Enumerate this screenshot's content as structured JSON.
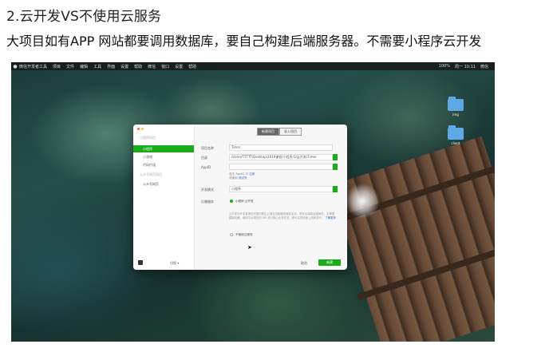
{
  "heading": "2.云开发VS不使用云服务",
  "paragraph": "大项目如有APP 网站都要调用数据库，要自己构建后端服务器。不需要小程序云开发",
  "menubar": {
    "apple": "",
    "items": [
      "微信开发者工具",
      "项目",
      "文件",
      "编辑",
      "工具",
      "界面",
      "设置",
      "帮助",
      "微信",
      "窗口",
      "设置",
      "帮助"
    ],
    "status": [
      "100%",
      "周一 10:11",
      "微信"
    ]
  },
  "desktop_icons": [
    {
      "label": "img",
      "icon": "folder-icon"
    },
    {
      "label": "client",
      "icon": "folder-icon"
    }
  ],
  "dialog": {
    "sidebar_group_1": "小程序项目",
    "sidebar_items": [
      "小程序",
      "小游戏",
      "代码片段"
    ],
    "sidebar_group_2": "公众号网页项目",
    "sidebar_item_web": "公众号网页",
    "sidebar_footer": "切换 ▾",
    "tabs": [
      "新建项目",
      "导入项目"
    ],
    "fields": {
      "name_label": "项目名称",
      "name_value": "Timer",
      "dir_label": "目录",
      "dir_value": "/Users/TTTTT/Desktop/2019课程/小程序/1/云开发/Timer",
      "appid_label": "AppID",
      "appid_value": "",
      "appid_hint1": "若无 AppID 可",
      "appid_hint1_link": "注册",
      "appid_hint2": "或使用",
      "appid_hint2_link": "测试号",
      "mode_label": "开发模式",
      "mode_value": "小程序",
      "backend_label": "后端服务",
      "backend_opt1": "小程序·云开发",
      "backend_desc": "云开发为开发者提供完整的原生云端支持和微信服务支持，弱化后端和运维概念，无需搭建服务器，使用平台提供的 API 进行核心业务开发，即可实现快速上线和迭代，",
      "backend_desc_link": "了解更多",
      "backend_opt2": "不使用云服务"
    },
    "cancel": "取消",
    "create": "新建"
  },
  "colors": {
    "accent": "#1aad19",
    "link": "#2b6acb"
  }
}
